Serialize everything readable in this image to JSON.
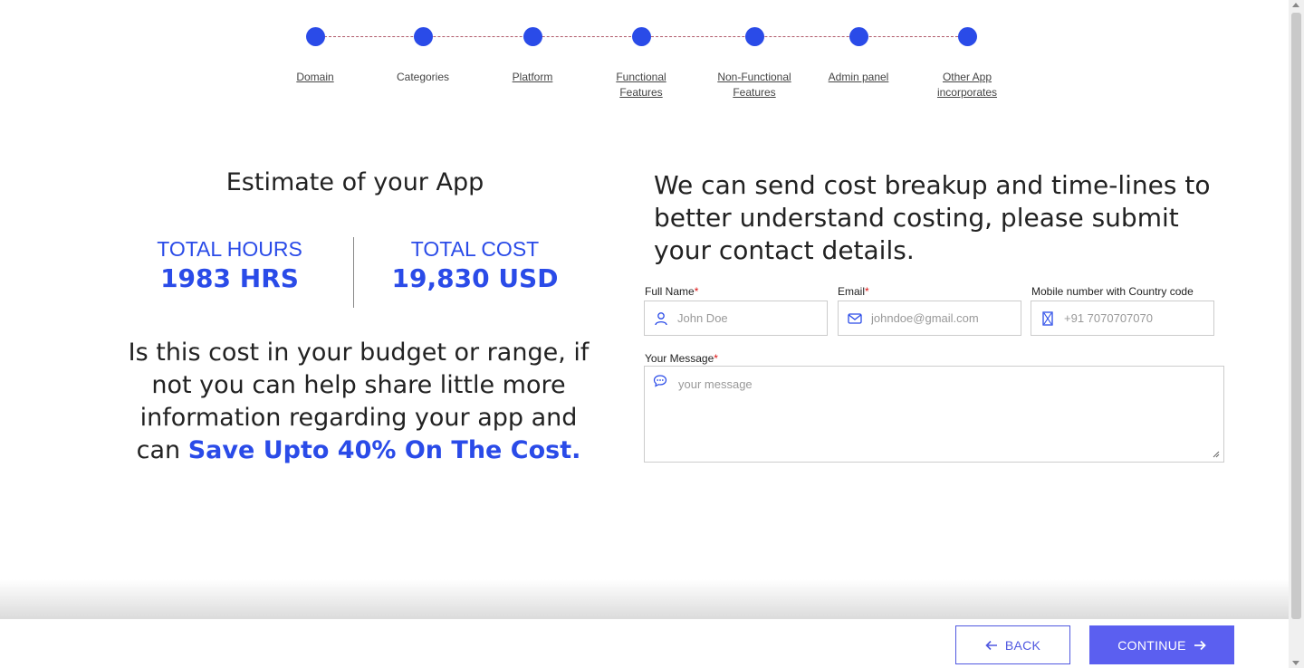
{
  "stepper": {
    "steps": [
      {
        "label": "Domain",
        "link": true
      },
      {
        "label": "Categories",
        "link": false
      },
      {
        "label": "Platform",
        "link": true
      },
      {
        "label": "Functional Features",
        "link": true
      },
      {
        "label": "Non-Functional Features",
        "link": true
      },
      {
        "label": "Admin panel",
        "link": true
      },
      {
        "label": "Other App incorporates",
        "link": true
      }
    ],
    "color": "#2a4be8"
  },
  "estimate": {
    "title": "Estimate of your App",
    "hours_label": "TOTAL HOURS",
    "hours_value": "1983 HRS",
    "cost_label": "TOTAL COST",
    "cost_value": "19,830 USD",
    "budget_text": "Is this cost in your budget or range, if not you can help share little more information regarding your app and can ",
    "budget_highlight": "Save Upto 40% On The Cost."
  },
  "contact": {
    "title": "We can send cost breakup and time-lines to better understand costing, please submit your contact details.",
    "full_name": {
      "label": "Full Name",
      "required": "*",
      "placeholder": "John Doe",
      "value": ""
    },
    "email": {
      "label": "Email",
      "required": "*",
      "placeholder": "johndoe@gmail.com",
      "value": ""
    },
    "mobile": {
      "label": "Mobile number with Country code",
      "placeholder": "+91 7070707070",
      "value": ""
    },
    "message": {
      "label": "Your Message",
      "required": "*",
      "placeholder": "your message",
      "value": ""
    }
  },
  "footer": {
    "back_label": "BACK",
    "continue_label": "CONTINUE"
  },
  "colors": {
    "accent": "#2a4be8",
    "button": "#5b5ff0",
    "required": "#dd1111"
  }
}
